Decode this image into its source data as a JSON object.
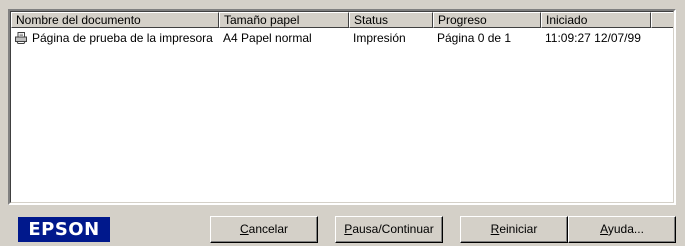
{
  "columns": [
    "Nombre del documento",
    "Tamaño papel",
    "Status",
    "Progreso",
    "Iniciado"
  ],
  "jobs": [
    {
      "document": "Página de prueba de la impresora",
      "paper": "A4 Papel normal",
      "status": "Impresión",
      "progress": "Página 0 de 1",
      "started": "11:09:27 12/07/99",
      "icon": "printer-document-icon"
    }
  ],
  "logo": "EPSON",
  "buttons": {
    "cancel": {
      "mnemonic": "C",
      "rest": "ancelar"
    },
    "pause": {
      "mnemonic": "P",
      "rest": "ausa/Continuar"
    },
    "restart": {
      "mnemonic": "R",
      "rest": "einiciar"
    },
    "help": {
      "mnemonic": "A",
      "rest": "yuda..."
    }
  },
  "colors": {
    "logo_bg": "#00188c",
    "face": "#d4d0c8",
    "list_bg": "#ffffff"
  }
}
